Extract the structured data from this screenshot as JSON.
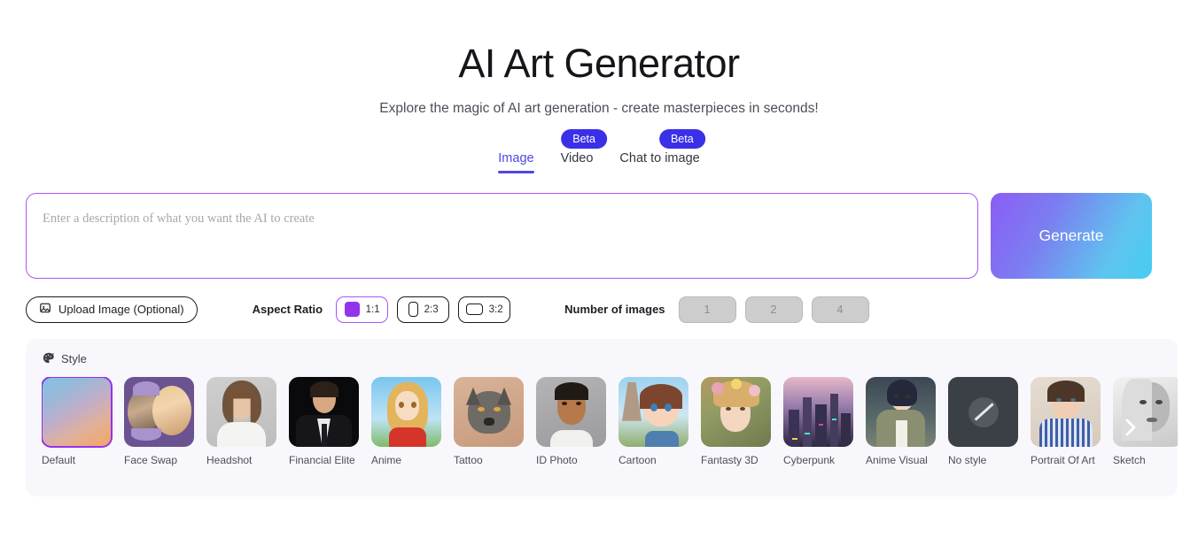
{
  "header": {
    "title": "AI Art Generator",
    "subtitle": "Explore the magic of AI art generation - create masterpieces in seconds!"
  },
  "tabs": [
    {
      "label": "Image",
      "active": true,
      "badge": ""
    },
    {
      "label": "Video",
      "active": false,
      "badge": "Beta"
    },
    {
      "label": "Chat to image",
      "active": false,
      "badge": "Beta"
    }
  ],
  "prompt": {
    "placeholder": "Enter a description of what you want the AI to create",
    "value": "",
    "generate_label": "Generate",
    "border_color": "#a855f7"
  },
  "options": {
    "upload_label": "Upload Image (Optional)",
    "upload_icon": "image-icon",
    "aspect_ratio_label": "Aspect Ratio",
    "aspect_ratios": [
      {
        "label": "1:1",
        "selected": true
      },
      {
        "label": "2:3",
        "selected": false
      },
      {
        "label": "3:2",
        "selected": false
      }
    ],
    "number_of_images_label": "Number of images",
    "number_options": [
      {
        "label": "1",
        "disabled": true
      },
      {
        "label": "2",
        "disabled": true
      },
      {
        "label": "4",
        "disabled": true
      }
    ]
  },
  "style": {
    "section_icon": "palette-icon",
    "section_label": "Style",
    "scroll_next_icon": "chevron-right-icon",
    "items": [
      {
        "label": "Default",
        "selected": true
      },
      {
        "label": "Face Swap",
        "selected": false
      },
      {
        "label": "Headshot",
        "selected": false
      },
      {
        "label": "Financial Elite",
        "selected": false
      },
      {
        "label": "Anime",
        "selected": false
      },
      {
        "label": "Tattoo",
        "selected": false
      },
      {
        "label": "ID Photo",
        "selected": false
      },
      {
        "label": "Cartoon",
        "selected": false
      },
      {
        "label": "Fantasty 3D",
        "selected": false
      },
      {
        "label": "Cyberpunk",
        "selected": false
      },
      {
        "label": "Anime Visual",
        "selected": false
      },
      {
        "label": "No style",
        "selected": false
      },
      {
        "label": "Portrait Of Art",
        "selected": false
      },
      {
        "label": "Sketch",
        "selected": false
      }
    ]
  },
  "colors": {
    "accent": "#4f46e5",
    "badge": "#3a30e8",
    "prompt_border": "#a855f7",
    "select_purple": "#9333ea",
    "panel_bg": "#f8f8fc"
  }
}
